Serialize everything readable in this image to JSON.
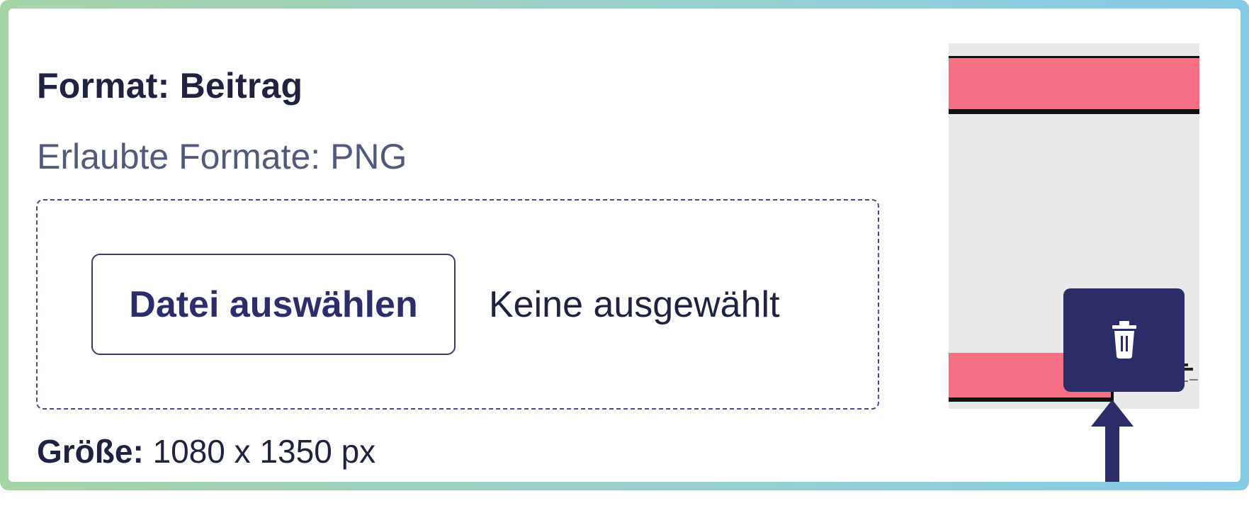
{
  "upload": {
    "format_title": "Format: Beitrag",
    "allowed_formats": "Erlaubte Formate: PNG",
    "choose_file_label": "Datei auswählen",
    "no_file_label": "Keine ausgewählt",
    "size_label": "Größe:",
    "size_value": "1080 x 1350 px"
  },
  "preview": {
    "accent_color": "#f66f82",
    "delete_button_color": "#2b2d66",
    "icons": {
      "delete": "trash-icon",
      "pointer": "up-arrow-icon"
    }
  },
  "theme": {
    "frame_gradient_start": "#a7d3a8",
    "frame_gradient_end": "#84cbe7",
    "text_color": "#1f2340",
    "secondary_text_color": "#525a79",
    "button_border_color": "#3a3b72"
  }
}
